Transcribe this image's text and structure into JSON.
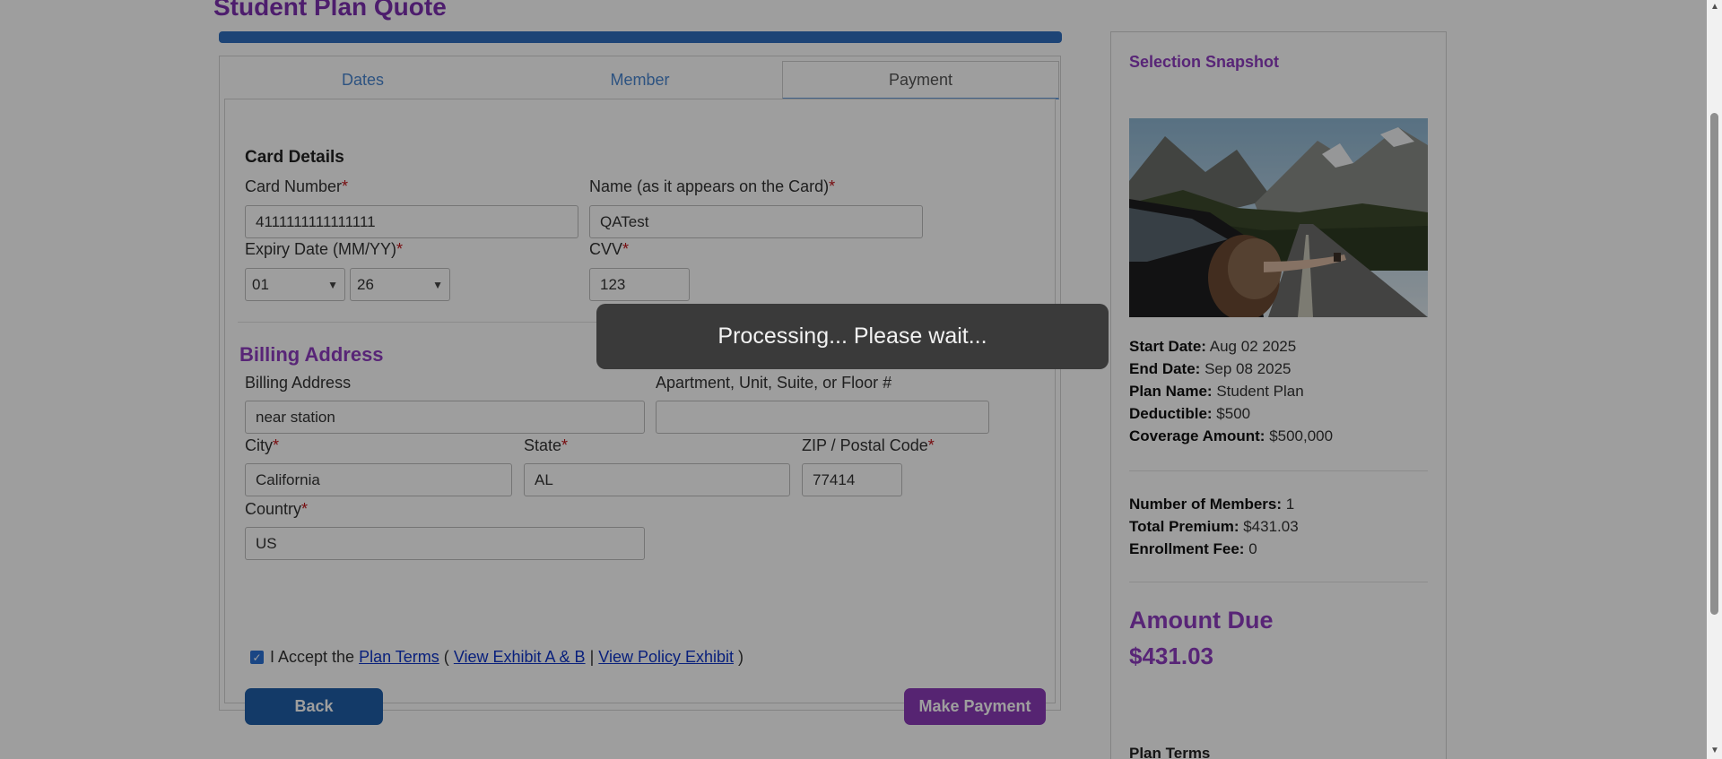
{
  "page": {
    "title": "Student Plan Quote"
  },
  "tabs": [
    {
      "label": "Dates"
    },
    {
      "label": "Member"
    },
    {
      "label": "Payment"
    }
  ],
  "card_details": {
    "heading": "Card Details",
    "card_number_label": "Card Number",
    "card_number_value": "4111111111111111",
    "name_label": "Name (as it appears on the Card)",
    "name_value": "QATest",
    "expiry_label": "Expiry Date (MM/YY)",
    "expiry_month": "01",
    "expiry_year": "26",
    "cvv_label": "CVV",
    "cvv_value": "123",
    "required_mark": "*"
  },
  "billing": {
    "heading": "Billing Address",
    "address_label": "Billing Address",
    "address_value": "near station",
    "apt_label": "Apartment, Unit, Suite, or Floor #",
    "apt_value": "",
    "city_label": "City",
    "city_value": "California",
    "state_label": "State",
    "state_value": "AL",
    "zip_label": "ZIP / Postal Code",
    "zip_value": "77414",
    "country_label": "Country",
    "country_value": "US"
  },
  "terms": {
    "checked": true,
    "prefix": "I Accept the",
    "plan_terms_link": "Plan Terms",
    "open_paren": "(",
    "exhibit_ab_link": "View Exhibit A & B",
    "separator": "|",
    "policy_exhibit_link": "View Policy Exhibit",
    "close_paren": ")"
  },
  "buttons": {
    "back": "Back",
    "make_payment": "Make Payment"
  },
  "sidebar": {
    "title": "Selection Snapshot",
    "start_date_label": "Start Date:",
    "start_date_value": "Aug 02 2025",
    "end_date_label": "End Date:",
    "end_date_value": "Sep 08 2025",
    "plan_name_label": "Plan Name:",
    "plan_name_value": "Student Plan",
    "deductible_label": "Deductible:",
    "deductible_value": "$500",
    "coverage_label": "Coverage Amount:",
    "coverage_value": "$500,000",
    "members_label": "Number of Members:",
    "members_value": "1",
    "premium_label": "Total Premium:",
    "premium_value": "$431.03",
    "enrollment_label": "Enrollment Fee:",
    "enrollment_value": "0",
    "amount_due_label": "Amount Due",
    "amount_due_value": "$431.03",
    "plan_terms_heading": "Plan Terms"
  },
  "overlay": {
    "message": "Processing... Please wait..."
  },
  "colors": {
    "brand_purple": "#8f3cc0",
    "primary_blue": "#1f5ea8",
    "link_blue": "#0f34c8",
    "required_red": "#c0151b"
  }
}
